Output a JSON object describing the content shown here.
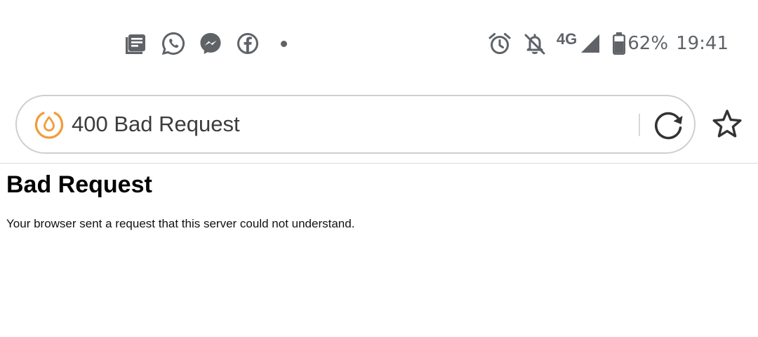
{
  "status_bar": {
    "notification_icons": [
      "news-icon",
      "whatsapp-icon",
      "messenger-icon",
      "facebook-icon",
      "more-notifications-dot"
    ],
    "system_icons": [
      "alarm-icon",
      "notifications-off-icon",
      "network-signal-icon",
      "battery-icon"
    ],
    "network_type": "4G",
    "battery_percent": "62%",
    "clock": "19:41",
    "icon_color": "#5f6368"
  },
  "browser": {
    "url_bar": {
      "site_icon": "site-droplet-icon",
      "page_title": "400 Bad Request",
      "reload_icon": "reload-icon"
    },
    "bookmark_icon": "star-icon",
    "accent_color": "#f29b38"
  },
  "page": {
    "heading": "Bad Request",
    "message": "Your browser sent a request that this server could not understand."
  }
}
